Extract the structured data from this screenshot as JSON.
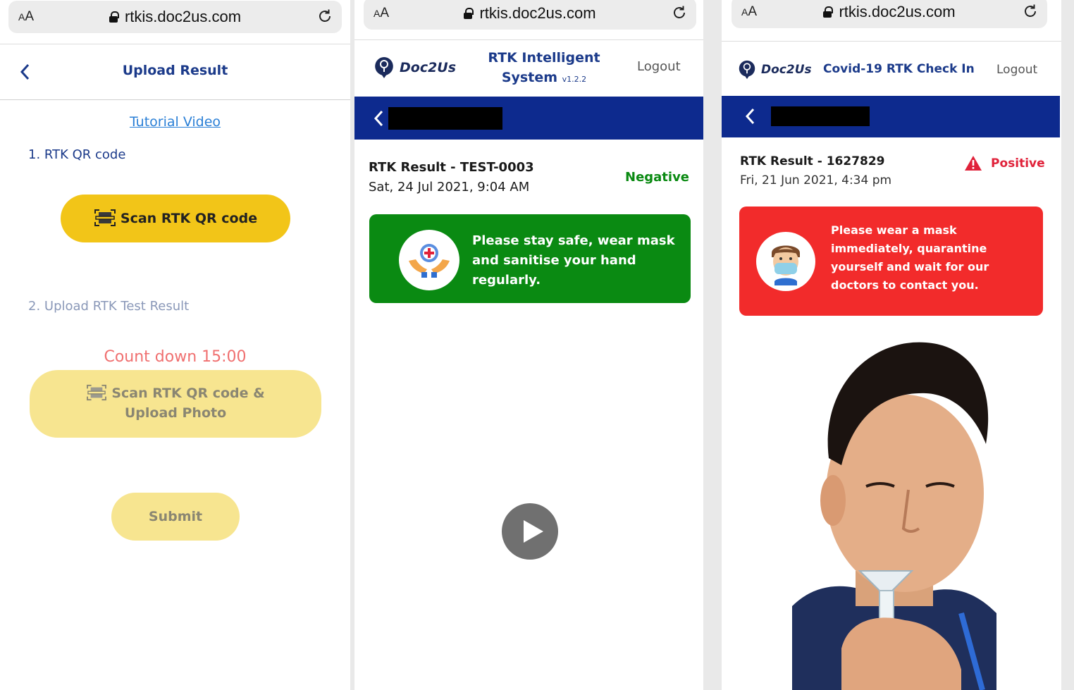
{
  "browser": {
    "aa_label_small": "A",
    "aa_label_big": "A",
    "url": "rtkis.doc2us.com"
  },
  "upload_screen": {
    "title": "Upload Result",
    "tutorial_link": "Tutorial Video",
    "step1_label": "1. RTK QR code",
    "scan_button": "Scan RTK QR code",
    "step2_label": "2. Upload RTK Test Result",
    "countdown": "Count down 15:00",
    "scan_upload_button_line1": "Scan RTK QR code &",
    "scan_upload_button_line2": "Upload Photo",
    "submit_button": "Submit",
    "colors": {
      "title": "#1b3a8a",
      "scan_button": "#f2c518",
      "disabled_button": "#f7e590",
      "countdown": "#f07070"
    }
  },
  "negative_screen": {
    "logo_text": "Doc2Us",
    "title_line1": "RTK Intelligent",
    "title_line2": "System",
    "version": "v1.2.2",
    "logout": "Logout",
    "result_title": "RTK Result - TEST-0003",
    "result_date": "Sat, 24 Jul 2021, 9:04 AM",
    "status": "Negative",
    "card_line1": "Please stay safe, wear mask",
    "card_line2": "and sanitise your hand",
    "card_line3": "regularly.",
    "colors": {
      "bar": "#0d2a8e",
      "card": "#0a8a12",
      "status": "#0a8a12"
    }
  },
  "positive_screen": {
    "logo_text": "Doc2Us",
    "title": "Covid-19 RTK Check In",
    "logout": "Logout",
    "result_title": "RTK Result - 1627829",
    "result_date": "Fri, 21 Jun 2021, 4:34 pm",
    "status": "Positive",
    "card_line1": "Please wear a mask",
    "card_line2": "immediately, quarantine",
    "card_line3": "yourself and wait for our",
    "card_line4": "doctors to contact you.",
    "colors": {
      "bar": "#0d2a8e",
      "card": "#f22b2b",
      "status": "#e0223a"
    }
  }
}
